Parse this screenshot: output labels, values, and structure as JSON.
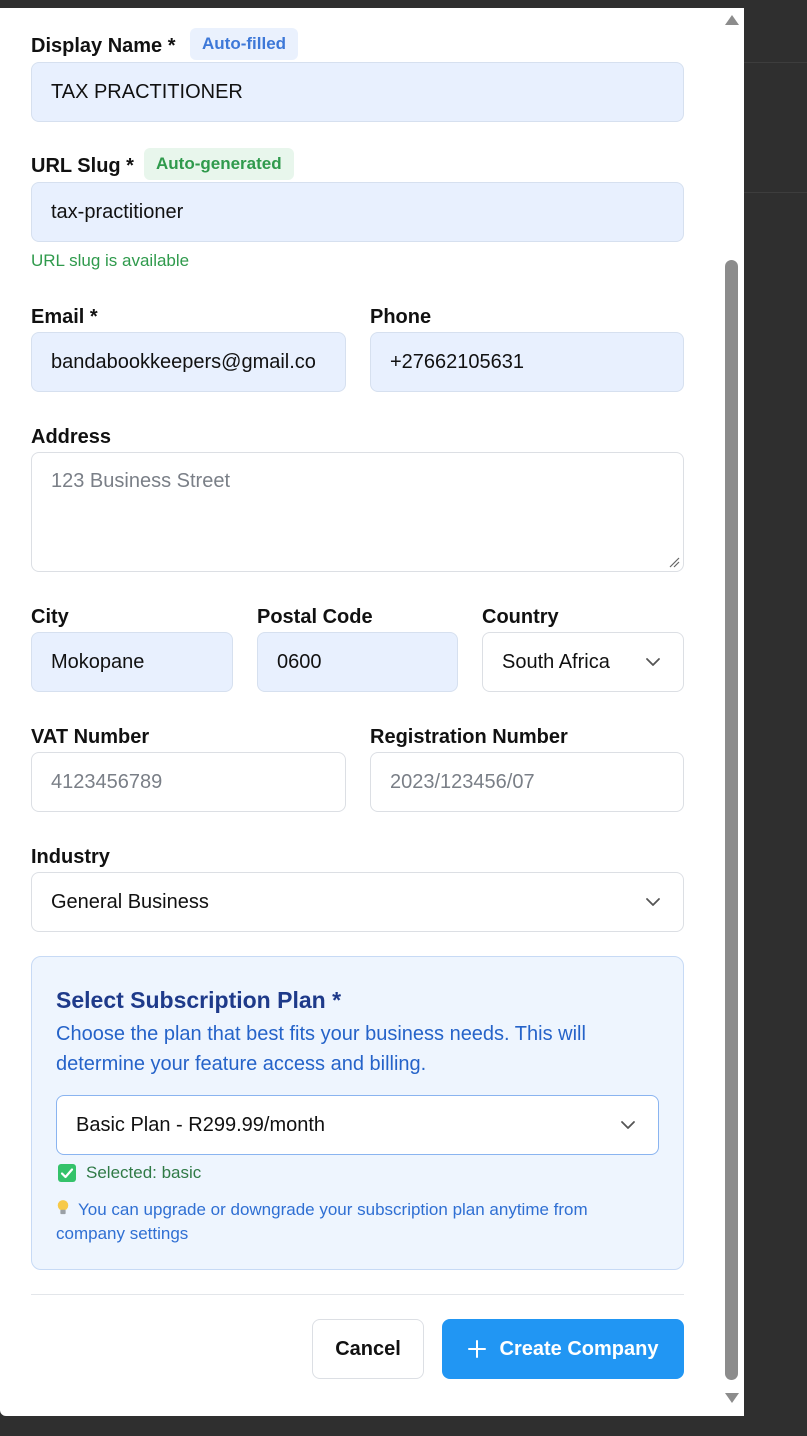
{
  "form": {
    "display_name": {
      "label": "Display Name *",
      "badge": "Auto-filled",
      "value": "TAX PRACTITIONER"
    },
    "url_slug": {
      "label": "URL Slug *",
      "badge": "Auto-generated",
      "value": "tax-practitioner",
      "helper": "URL slug is available"
    },
    "email": {
      "label": "Email *",
      "value": "bandabookkeepers@gmail.co"
    },
    "phone": {
      "label": "Phone",
      "value": "+27662105631"
    },
    "address": {
      "label": "Address",
      "placeholder": "123 Business Street"
    },
    "city": {
      "label": "City",
      "value": "Mokopane"
    },
    "postal_code": {
      "label": "Postal Code",
      "value": "0600"
    },
    "country": {
      "label": "Country",
      "value": "South Africa"
    },
    "vat_number": {
      "label": "VAT Number",
      "placeholder": "4123456789"
    },
    "registration_number": {
      "label": "Registration Number",
      "placeholder": "2023/123456/07"
    },
    "industry": {
      "label": "Industry",
      "value": "General Business"
    }
  },
  "plan": {
    "title": "Select Subscription Plan *",
    "description": "Choose the plan that best fits your business needs. This will determine your feature access and billing.",
    "selected_option": "Basic Plan - R299.99/month",
    "selected_text": "Selected: basic",
    "tip": "You can upgrade or downgrade your subscription plan anytime from company settings"
  },
  "actions": {
    "cancel": "Cancel",
    "create": "Create Company"
  },
  "colors": {
    "accent": "#2196f3",
    "filled_input": "#e8f0fe",
    "success": "#2f9a4c",
    "plan_title": "#1e3a8a"
  },
  "icons": [
    "chevron-down-icon",
    "check-icon",
    "lightbulb-icon",
    "plus-icon",
    "scroll-up-arrow-icon",
    "scroll-down-arrow-icon",
    "resize-grip-icon"
  ]
}
